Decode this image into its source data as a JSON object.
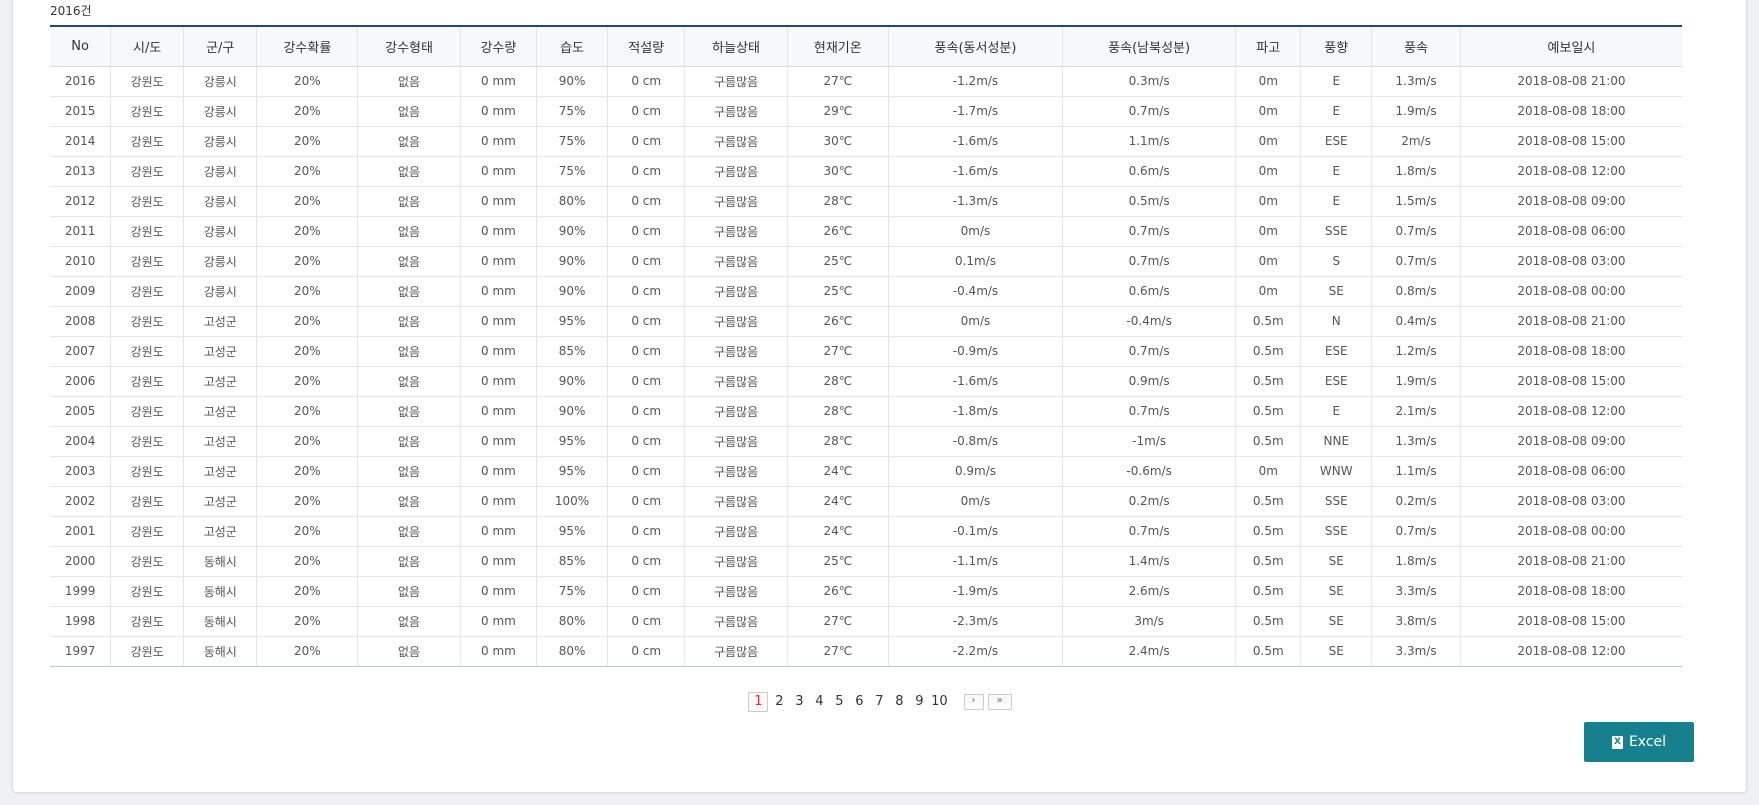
{
  "summary": {
    "count": "2016건"
  },
  "table": {
    "columns": [
      "No",
      "시/도",
      "군/구",
      "강수확률",
      "강수형태",
      "강수량",
      "습도",
      "적설량",
      "하늘상태",
      "현재기온",
      "풍속(동서성분)",
      "풍속(남북성분)",
      "파고",
      "풍향",
      "풍속",
      "예보일시"
    ],
    "rows": [
      [
        "2016",
        "강원도",
        "강릉시",
        "20%",
        "없음",
        "0 mm",
        "90%",
        "0 cm",
        "구름많음",
        "27℃",
        "-1.2m/s",
        "0.3m/s",
        "0m",
        "E",
        "1.3m/s",
        "2018-08-08 21:00"
      ],
      [
        "2015",
        "강원도",
        "강릉시",
        "20%",
        "없음",
        "0 mm",
        "75%",
        "0 cm",
        "구름많음",
        "29℃",
        "-1.7m/s",
        "0.7m/s",
        "0m",
        "E",
        "1.9m/s",
        "2018-08-08 18:00"
      ],
      [
        "2014",
        "강원도",
        "강릉시",
        "20%",
        "없음",
        "0 mm",
        "75%",
        "0 cm",
        "구름많음",
        "30℃",
        "-1.6m/s",
        "1.1m/s",
        "0m",
        "ESE",
        "2m/s",
        "2018-08-08 15:00"
      ],
      [
        "2013",
        "강원도",
        "강릉시",
        "20%",
        "없음",
        "0 mm",
        "75%",
        "0 cm",
        "구름많음",
        "30℃",
        "-1.6m/s",
        "0.6m/s",
        "0m",
        "E",
        "1.8m/s",
        "2018-08-08 12:00"
      ],
      [
        "2012",
        "강원도",
        "강릉시",
        "20%",
        "없음",
        "0 mm",
        "80%",
        "0 cm",
        "구름많음",
        "28℃",
        "-1.3m/s",
        "0.5m/s",
        "0m",
        "E",
        "1.5m/s",
        "2018-08-08 09:00"
      ],
      [
        "2011",
        "강원도",
        "강릉시",
        "20%",
        "없음",
        "0 mm",
        "90%",
        "0 cm",
        "구름많음",
        "26℃",
        "0m/s",
        "0.7m/s",
        "0m",
        "SSE",
        "0.7m/s",
        "2018-08-08 06:00"
      ],
      [
        "2010",
        "강원도",
        "강릉시",
        "20%",
        "없음",
        "0 mm",
        "90%",
        "0 cm",
        "구름많음",
        "25℃",
        "0.1m/s",
        "0.7m/s",
        "0m",
        "S",
        "0.7m/s",
        "2018-08-08 03:00"
      ],
      [
        "2009",
        "강원도",
        "강릉시",
        "20%",
        "없음",
        "0 mm",
        "90%",
        "0 cm",
        "구름많음",
        "25℃",
        "-0.4m/s",
        "0.6m/s",
        "0m",
        "SE",
        "0.8m/s",
        "2018-08-08 00:00"
      ],
      [
        "2008",
        "강원도",
        "고성군",
        "20%",
        "없음",
        "0 mm",
        "95%",
        "0 cm",
        "구름많음",
        "26℃",
        "0m/s",
        "-0.4m/s",
        "0.5m",
        "N",
        "0.4m/s",
        "2018-08-08 21:00"
      ],
      [
        "2007",
        "강원도",
        "고성군",
        "20%",
        "없음",
        "0 mm",
        "85%",
        "0 cm",
        "구름많음",
        "27℃",
        "-0.9m/s",
        "0.7m/s",
        "0.5m",
        "ESE",
        "1.2m/s",
        "2018-08-08 18:00"
      ],
      [
        "2006",
        "강원도",
        "고성군",
        "20%",
        "없음",
        "0 mm",
        "90%",
        "0 cm",
        "구름많음",
        "28℃",
        "-1.6m/s",
        "0.9m/s",
        "0.5m",
        "ESE",
        "1.9m/s",
        "2018-08-08 15:00"
      ],
      [
        "2005",
        "강원도",
        "고성군",
        "20%",
        "없음",
        "0 mm",
        "90%",
        "0 cm",
        "구름많음",
        "28℃",
        "-1.8m/s",
        "0.7m/s",
        "0.5m",
        "E",
        "2.1m/s",
        "2018-08-08 12:00"
      ],
      [
        "2004",
        "강원도",
        "고성군",
        "20%",
        "없음",
        "0 mm",
        "95%",
        "0 cm",
        "구름많음",
        "28℃",
        "-0.8m/s",
        "-1m/s",
        "0.5m",
        "NNE",
        "1.3m/s",
        "2018-08-08 09:00"
      ],
      [
        "2003",
        "강원도",
        "고성군",
        "20%",
        "없음",
        "0 mm",
        "95%",
        "0 cm",
        "구름많음",
        "24℃",
        "0.9m/s",
        "-0.6m/s",
        "0m",
        "WNW",
        "1.1m/s",
        "2018-08-08 06:00"
      ],
      [
        "2002",
        "강원도",
        "고성군",
        "20%",
        "없음",
        "0 mm",
        "100%",
        "0 cm",
        "구름많음",
        "24℃",
        "0m/s",
        "0.2m/s",
        "0.5m",
        "SSE",
        "0.2m/s",
        "2018-08-08 03:00"
      ],
      [
        "2001",
        "강원도",
        "고성군",
        "20%",
        "없음",
        "0 mm",
        "95%",
        "0 cm",
        "구름많음",
        "24℃",
        "-0.1m/s",
        "0.7m/s",
        "0.5m",
        "SSE",
        "0.7m/s",
        "2018-08-08 00:00"
      ],
      [
        "2000",
        "강원도",
        "동해시",
        "20%",
        "없음",
        "0 mm",
        "85%",
        "0 cm",
        "구름많음",
        "25℃",
        "-1.1m/s",
        "1.4m/s",
        "0.5m",
        "SE",
        "1.8m/s",
        "2018-08-08 21:00"
      ],
      [
        "1999",
        "강원도",
        "동해시",
        "20%",
        "없음",
        "0 mm",
        "75%",
        "0 cm",
        "구름많음",
        "26℃",
        "-1.9m/s",
        "2.6m/s",
        "0.5m",
        "SE",
        "3.3m/s",
        "2018-08-08 18:00"
      ],
      [
        "1998",
        "강원도",
        "동해시",
        "20%",
        "없음",
        "0 mm",
        "80%",
        "0 cm",
        "구름많음",
        "27℃",
        "-2.3m/s",
        "3m/s",
        "0.5m",
        "SE",
        "3.8m/s",
        "2018-08-08 15:00"
      ],
      [
        "1997",
        "강원도",
        "동해시",
        "20%",
        "없음",
        "0 mm",
        "80%",
        "0 cm",
        "구름많음",
        "27℃",
        "-2.2m/s",
        "2.4m/s",
        "0.5m",
        "SE",
        "3.3m/s",
        "2018-08-08 12:00"
      ]
    ]
  },
  "pagination": {
    "pages": [
      "1",
      "2",
      "3",
      "4",
      "5",
      "6",
      "7",
      "8",
      "9",
      "10"
    ],
    "current": "1",
    "next_icon": "chevron-right-icon",
    "last_icon": "double-chevron-right-icon"
  },
  "export": {
    "label": "Excel",
    "icon": "excel-file-icon",
    "color": "#17808f"
  },
  "colors": {
    "header_border": "#234a6b",
    "active_page": "#d0353a"
  }
}
